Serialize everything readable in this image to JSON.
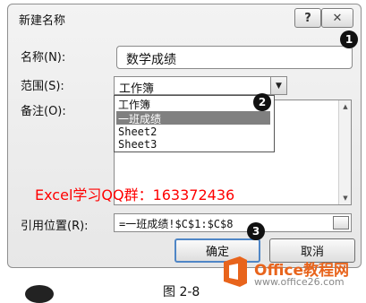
{
  "dialog": {
    "title": "新建名称",
    "help_button": "?",
    "close_button": "✕"
  },
  "form": {
    "name_label": "名称(N):",
    "name_value": "数学成绩",
    "scope_label": "范围(S):",
    "scope_value": "工作簿",
    "note_label": "备注(O):",
    "scope_options": [
      "工作簿",
      "一班成绩",
      "Sheet2",
      "Sheet3"
    ],
    "scope_highlighted": "一班成绩",
    "ref_label": "引用位置(R):",
    "ref_value": "=一班成绩!$C$1:$C$8"
  },
  "buttons": {
    "ok": "确定",
    "cancel": "取消"
  },
  "markers": [
    "1",
    "2",
    "3"
  ],
  "overlay_text": "Excel学习QQ群：163372436",
  "caption": "图 2-8",
  "logo": {
    "name": "Office教程网",
    "url": "www.office26.com"
  },
  "colors": {
    "watermark": "#ff0000",
    "logo_orange": "#e8641c",
    "highlight": "#808080"
  }
}
